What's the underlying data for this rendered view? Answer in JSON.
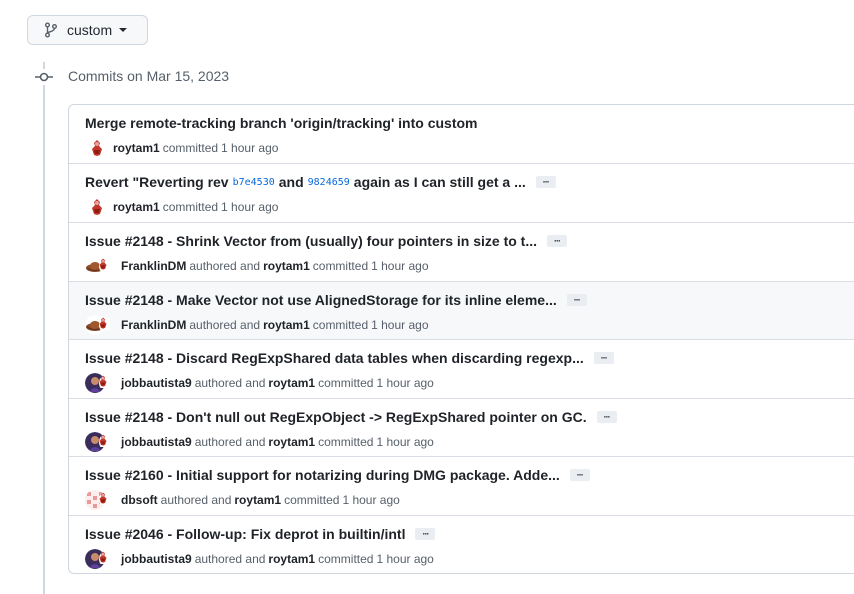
{
  "branch": {
    "name": "custom"
  },
  "group": {
    "heading": "Commits on Mar 15, 2023"
  },
  "commits": [
    {
      "title": "Merge remote-tracking branch 'origin/tracking' into custom",
      "author": "roytam1",
      "text_committed": "committed",
      "time": "1 hour ago"
    },
    {
      "title_pre": "Revert \"Reverting rev",
      "sha1": "b7e4530",
      "title_mid": "and",
      "sha2": "9824659",
      "title_post": "again as I can still get a ...",
      "author": "roytam1",
      "text_committed": "committed",
      "time": "1 hour ago"
    },
    {
      "title": "Issue #2148 - Shrink Vector from (usually) four pointers in size to t...",
      "author": "FranklinDM",
      "text_authored": "authored and",
      "committer": "roytam1",
      "text_committed": "committed",
      "time": "1 hour ago"
    },
    {
      "title": "Issue #2148 - Make Vector not use AlignedStorage for its inline eleme...",
      "author": "FranklinDM",
      "text_authored": "authored and",
      "committer": "roytam1",
      "text_committed": "committed",
      "time": "1 hour ago"
    },
    {
      "title": "Issue #2148 - Discard RegExpShared data tables when discarding regexp...",
      "author": "jobbautista9",
      "text_authored": "authored and",
      "committer": "roytam1",
      "text_committed": "committed",
      "time": "1 hour ago"
    },
    {
      "title": "Issue #2148 - Don't null out RegExpObject -> RegExpShared pointer on GC.",
      "author": "jobbautista9",
      "text_authored": "authored and",
      "committer": "roytam1",
      "text_committed": "committed",
      "time": "1 hour ago"
    },
    {
      "title": "Issue #2160 - Initial support for notarizing during DMG package. Adde...",
      "author": "dbsoft",
      "text_authored": "authored and",
      "committer": "roytam1",
      "text_committed": "committed",
      "time": "1 hour ago"
    },
    {
      "title": "Issue #2046 - Follow-up: Fix deprot in builtin/intl",
      "author": "jobbautista9",
      "text_authored": "authored and",
      "committer": "roytam1",
      "text_committed": "committed",
      "time": "1 hour ago"
    }
  ],
  "ui": {
    "ellipsis": "···"
  }
}
